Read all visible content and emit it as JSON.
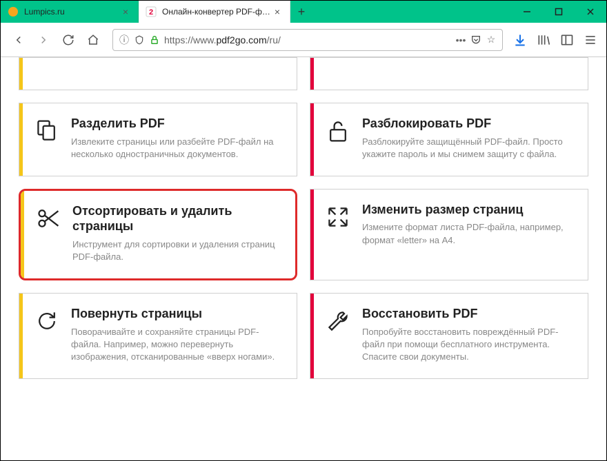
{
  "tabs": [
    {
      "title": "Lumpics.ru",
      "active": false
    },
    {
      "title": "Онлайн-конвертер PDF-файл",
      "active": true
    }
  ],
  "url": {
    "prefix": "https://www.",
    "domain": "pdf2go.com",
    "path": "/ru/"
  },
  "cards": {
    "split": {
      "title": "Разделить PDF",
      "desc": "Извлеките страницы или разбейте PDF-файл на несколько одностраничных документов."
    },
    "unlock": {
      "title": "Разблокировать PDF",
      "desc": "Разблокируйте защищённый PDF-файл. Просто укажите пароль и мы снимем защиту с файла."
    },
    "sort_delete": {
      "title": "Отсортировать и удалить страницы",
      "desc": "Инструмент для сортировки и удаления страниц PDF-файла."
    },
    "resize": {
      "title": "Изменить размер страниц",
      "desc": "Измените формат листа PDF-файла, например, формат «letter» на A4."
    },
    "rotate": {
      "title": "Повернуть страницы",
      "desc": "Поворачивайте и сохраняйте страницы PDF-файла. Например, можно перевернуть изображения, отсканированные «вверх ногами»."
    },
    "repair": {
      "title": "Восстановить PDF",
      "desc": "Попробуйте восстановить повреждённый PDF-файл при помощи бесплатного инструмента. Спасите свои документы."
    }
  }
}
